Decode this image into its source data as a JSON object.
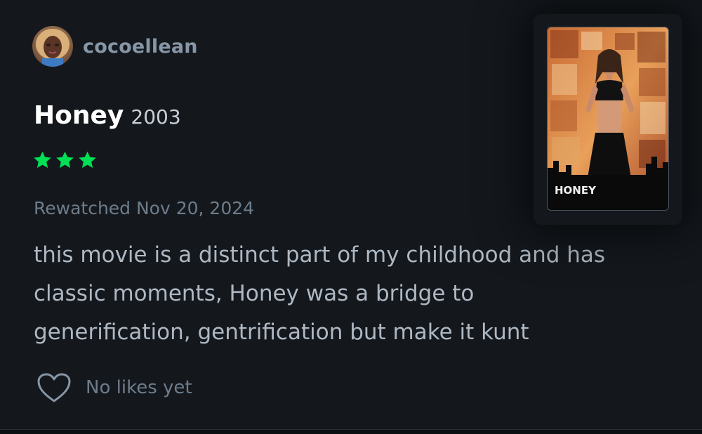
{
  "review": {
    "author": {
      "username": "cocoellean",
      "avatar_icon": "avatar"
    },
    "film": {
      "title": "Honey",
      "year": "2003",
      "poster_title": "HONEY"
    },
    "rating": {
      "stars": 3,
      "max_stars": 5,
      "star_color": "#00e054"
    },
    "watched_label": "Rewatched Nov 20, 2024",
    "body_lines": [
      "this movie is a distinct part of my childhood and has",
      "classic moments, Honey was a bridge to",
      "generification, gentrification but make it kunt"
    ],
    "likes": {
      "icon": "heart-outline-icon",
      "text": "No likes yet"
    }
  },
  "colors": {
    "background": "#14181d",
    "username": "#8796a6",
    "muted": "#6e7c8a",
    "body_text": "#aeb8c3",
    "accent_green": "#00e054"
  }
}
